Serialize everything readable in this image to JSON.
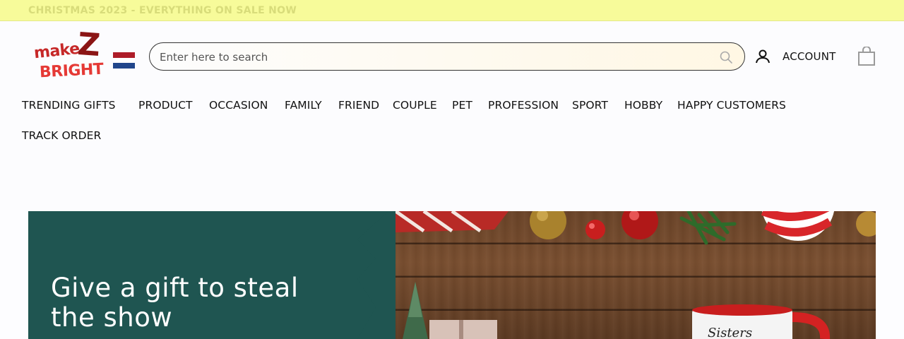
{
  "announcement": {
    "text": "CHRISTMAS 2023 - EVERYTHING ON SALE NOW"
  },
  "brand": {
    "logo_lines": [
      "make",
      "Z",
      "BRIGHT"
    ],
    "flag": "netherlands-flag",
    "colors": {
      "logo_red": "#c62828",
      "logo_dark": "#8b1515",
      "announce_bg": "#f7fb9a",
      "hero_green": "#1f5551"
    }
  },
  "search": {
    "placeholder": "Enter here to search",
    "value": "",
    "icon": "search-icon"
  },
  "account": {
    "label": "ACCOUNT",
    "icon": "user-icon"
  },
  "cart": {
    "icon": "shopping-bag-icon"
  },
  "nav": {
    "items": [
      {
        "label": "TRENDING GIFTS"
      },
      {
        "label": "PRODUCT"
      },
      {
        "label": "OCCASION"
      },
      {
        "label": "FAMILY"
      },
      {
        "label": "FRIEND"
      },
      {
        "label": "COUPLE"
      },
      {
        "label": "PET"
      },
      {
        "label": "PROFESSION"
      },
      {
        "label": "SPORT"
      },
      {
        "label": "HOBBY"
      },
      {
        "label": "HAPPY CUSTOMERS"
      },
      {
        "label": "TRACK ORDER"
      }
    ]
  },
  "hero": {
    "title": "Give a gift to steal the show"
  }
}
